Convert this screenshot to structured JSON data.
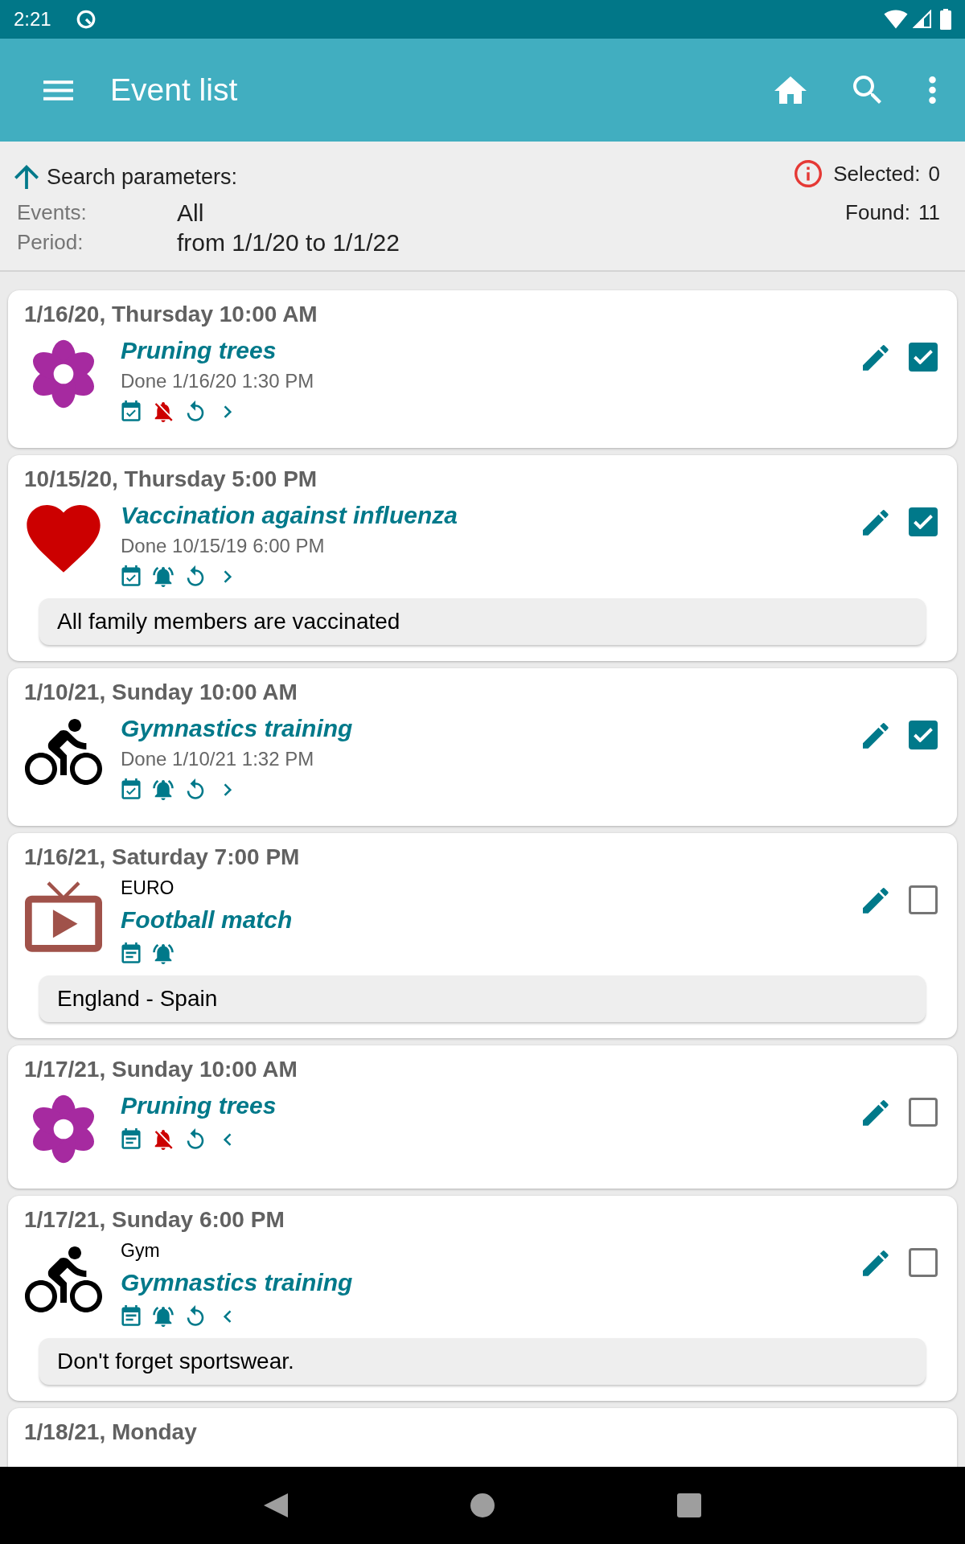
{
  "status_bar": {
    "time": "2:21"
  },
  "toolbar": {
    "title": "Event list"
  },
  "search_parameters": {
    "heading": "Search parameters:",
    "rows": [
      {
        "label": "Events:",
        "value": "All"
      },
      {
        "label": "Period:",
        "value": "from 1/1/20 to 1/1/22"
      }
    ],
    "selected": {
      "label": "Selected:",
      "value": "0"
    },
    "found": {
      "label": "Found:",
      "value": "11"
    }
  },
  "events": [
    {
      "date": "1/16/20, Thursday 10:00 AM",
      "kind": "flower",
      "color": "#a62aa0",
      "title": "Pruning trees",
      "done": "Done 1/16/20 1:30 PM",
      "completed": true,
      "alarm": false,
      "repeat": true,
      "has_next": true,
      "has_previous": false,
      "checked": true
    },
    {
      "date": "10/15/20, Thursday 5:00 PM",
      "kind": "heart",
      "color": "#cc0000",
      "title": "Vaccination against influenza",
      "done": "Done 10/15/19 6:00 PM",
      "completed": true,
      "alarm": true,
      "repeat": true,
      "has_next": true,
      "has_previous": false,
      "checked": true,
      "note": "All family members are vaccinated"
    },
    {
      "date": "1/10/21, Sunday 10:00 AM",
      "kind": "bicycle",
      "color": "#000000",
      "title": "Gymnastics training",
      "done": "Done 1/10/21 1:32 PM",
      "completed": true,
      "alarm": true,
      "repeat": true,
      "has_next": true,
      "has_previous": false,
      "checked": true
    },
    {
      "date": "1/16/21, Saturday 7:00 PM",
      "kind": "tv",
      "color": "#a0524a",
      "category": "EURO",
      "title": "Football match",
      "completed": false,
      "alarm": true,
      "repeat": false,
      "has_next": false,
      "has_previous": false,
      "checked": false,
      "note": "England - Spain"
    },
    {
      "date": "1/17/21, Sunday 10:00 AM",
      "kind": "flower",
      "color": "#a62aa0",
      "title": "Pruning trees",
      "completed": false,
      "alarm": false,
      "repeat": true,
      "has_next": false,
      "has_previous": true,
      "checked": false
    },
    {
      "date": "1/17/21, Sunday 6:00 PM",
      "kind": "bicycle",
      "color": "#000000",
      "category": "Gym",
      "title": "Gymnastics training",
      "completed": false,
      "alarm": true,
      "repeat": true,
      "has_next": false,
      "has_previous": true,
      "checked": false,
      "note": "Don't forget sportswear."
    },
    {
      "date": "1/18/21, Monday"
    }
  ]
}
